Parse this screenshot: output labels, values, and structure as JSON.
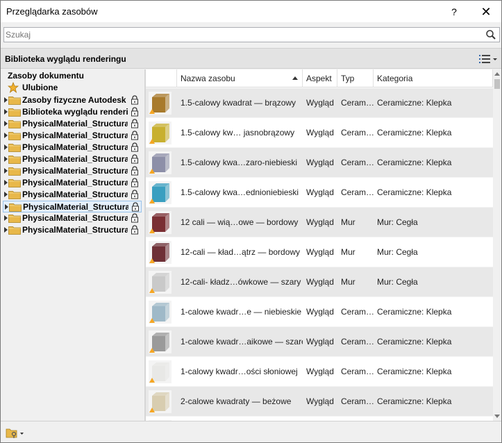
{
  "window": {
    "title": "Przeglądarka zasobów",
    "help_label": "?",
    "close_label": "✕"
  },
  "search": {
    "placeholder": "Szukaj"
  },
  "library": {
    "title": "Biblioteka wyglądu renderingu"
  },
  "tree": {
    "document_assets": "Zasoby dokumentu",
    "favorites": "Ulubione",
    "items": [
      {
        "label": "Zasoby fizyczne Autodesk",
        "locked": true
      },
      {
        "label": "Biblioteka wyglądu renderingu",
        "locked": true
      },
      {
        "label": "PhysicalMaterial_Structural",
        "locked": true
      },
      {
        "label": "PhysicalMaterial_Structural",
        "locked": true
      },
      {
        "label": "PhysicalMaterial_Structural",
        "locked": true
      },
      {
        "label": "PhysicalMaterial_Structural",
        "locked": true
      },
      {
        "label": "PhysicalMaterial_Structural",
        "locked": true
      },
      {
        "label": "PhysicalMaterial_Structural",
        "locked": true
      },
      {
        "label": "PhysicalMaterial_Structural",
        "locked": true
      },
      {
        "label": "PhysicalMaterial_Structural",
        "locked": true,
        "selected": true
      },
      {
        "label": "PhysicalMaterial_Structural",
        "locked": true
      },
      {
        "label": "PhysicalMaterial_Structural",
        "locked": true
      }
    ]
  },
  "table": {
    "columns": [
      "Nazwa zasobu",
      "Aspekt",
      "Typ",
      "Kategoria"
    ],
    "sort_column": "Nazwa zasobu",
    "rows": [
      {
        "name": "1.5-calowy kwadrat — brązowy",
        "aspect": "Wygląd",
        "type": "Ceram…",
        "category": "Ceramiczne: Klepka",
        "swatch": "#a87a2c"
      },
      {
        "name": "1.5-calowy kw… jasnobrązowy",
        "aspect": "Wygląd",
        "type": "Ceram…",
        "category": "Ceramiczne: Klepka",
        "swatch": "#c8b030"
      },
      {
        "name": "1.5-calowy kwa…zaro-niebieski",
        "aspect": "Wygląd",
        "type": "Ceram…",
        "category": "Ceramiczne: Klepka",
        "swatch": "#8d8fa8"
      },
      {
        "name": "1.5-calowy kwa…ednioniebieski",
        "aspect": "Wygląd",
        "type": "Ceram…",
        "category": "Ceramiczne: Klepka",
        "swatch": "#3a9fc0"
      },
      {
        "name": "12 cali — wią…owe — bordowy",
        "aspect": "Wygląd",
        "type": "Mur",
        "category": "Mur: Cegła",
        "swatch": "#7a2e33"
      },
      {
        "name": "12-cali — kład…ątrz — bordowy",
        "aspect": "Wygląd",
        "type": "Mur",
        "category": "Mur: Cegła",
        "swatch": "#6e3037"
      },
      {
        "name": "12-cali- kładz…ówkowe — szary",
        "aspect": "Wygląd",
        "type": "Mur",
        "category": "Mur: Cegła",
        "swatch": "#c9c9c9"
      },
      {
        "name": "1-calowe kwadr…e — niebieskie",
        "aspect": "Wygląd",
        "type": "Ceram…",
        "category": "Ceramiczne: Klepka",
        "swatch": "#9fb9c8"
      },
      {
        "name": "1-calowe kwadr…aikowe — szare",
        "aspect": "Wygląd",
        "type": "Ceram…",
        "category": "Ceramiczne: Klepka",
        "swatch": "#9a9a9a"
      },
      {
        "name": "1-calowy kwadr…ości słoniowej",
        "aspect": "Wygląd",
        "type": "Ceram…",
        "category": "Ceramiczne: Klepka",
        "swatch": "#e8e8e6"
      },
      {
        "name": "2-calowe kwadraty — beżowe",
        "aspect": "Wygląd",
        "type": "Ceram…",
        "category": "Ceramiczne: Klepka",
        "swatch": "#d8cdb0"
      },
      {
        "name": "",
        "aspect": "",
        "type": "",
        "category": "",
        "swatch": "#b0a0a0"
      }
    ]
  },
  "colors": {
    "selection_fill": "#e5f0fb",
    "selection_border": "#99c2ea",
    "folder": "#e8b84a",
    "warning_badge": "#f5a623"
  }
}
